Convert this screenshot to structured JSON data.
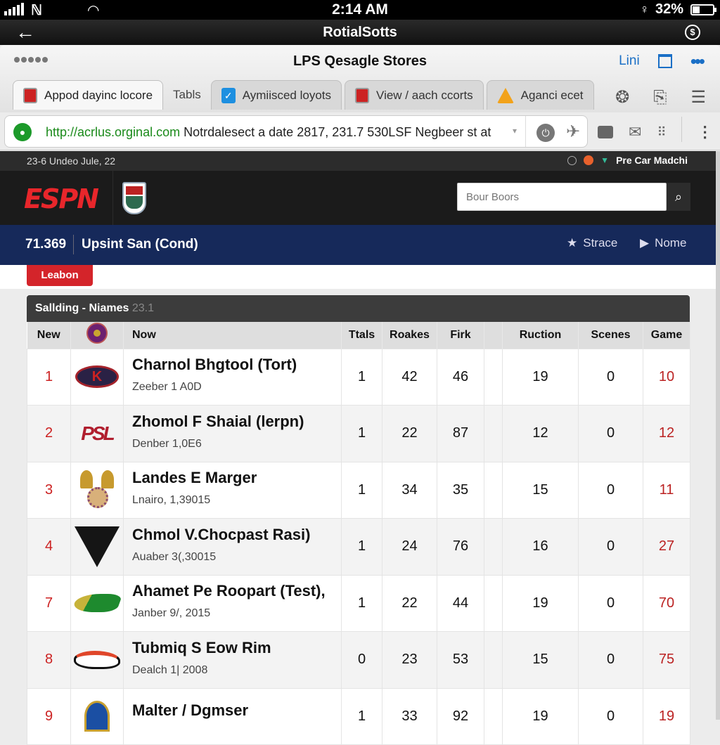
{
  "status_bar": {
    "carrier": "ℕ",
    "time": "2:14 AM",
    "battery_text": "32%",
    "battery_level": 0.32
  },
  "app_bar": {
    "title": "RotialSotts",
    "back_icon": "←",
    "info_icon": "$"
  },
  "browser": {
    "page_title": "LPS Qesagle Stores",
    "top_right_link": "Lini",
    "more_icon": "•••",
    "tabs": [
      {
        "label": "Appod dayinc locore",
        "icon": "shield-icon",
        "active": true
      },
      {
        "label": "Tabls",
        "icon": "",
        "active": false
      },
      {
        "label": "Aymiisced loyots",
        "icon": "bird-icon",
        "active": false
      },
      {
        "label": "View / aach ccorts",
        "icon": "shield-icon",
        "active": false
      },
      {
        "label": "Aganci ecet",
        "icon": "triangle-icon",
        "active": false
      }
    ],
    "tab_tools": {
      "menu_icon": "☰",
      "clip_icon": "⎘",
      "emblem_icon": "❂"
    },
    "address": {
      "host": "http://acrlus.orginal.com",
      "rest": " Notrdalesect a date 2817, 231.7 530LSF Negbeer st at",
      "secure_icon": "⬤"
    },
    "address_tools": {
      "mail_icon": "✉",
      "apps_icon": "⠿",
      "kebab_icon": "⋮",
      "power_icon": "⏻",
      "plane_icon": "✈"
    }
  },
  "info_strip": {
    "left": "23-6 Undeo Jule, 22",
    "right": "Pre Car Madchi"
  },
  "espn": {
    "logo": "ESPN",
    "search_placeholder": "Bour Boors",
    "search_icon": "⌕"
  },
  "nav": {
    "number": "71.369",
    "team": "Upsint San (Cond)",
    "actions": [
      {
        "icon": "★",
        "label": "Strace"
      },
      {
        "icon": "▶",
        "label": "Nome"
      }
    ]
  },
  "leabon_button": "Leabon",
  "standings": {
    "title": "Sallding - ",
    "title_strong": "Niames",
    "title_dim": "23.1",
    "columns": [
      "New",
      "",
      "Now",
      "Ttals",
      "Roakes",
      "Firk",
      "",
      "Ruction",
      "Scenes",
      "Game"
    ],
    "rows": [
      {
        "rank": "1",
        "logo": "k-logo",
        "name": "Charnol Bhgtool (Tort)",
        "sub": "Zeeber 1 A0D",
        "ttals": "1",
        "roakes": "42",
        "firk": "46",
        "ruction": "19",
        "scenes": "0",
        "game": "10"
      },
      {
        "rank": "2",
        "logo": "psl-logo",
        "name": "Zhomol F Shaial (lerpn)",
        "sub": "Denber 1,0E6",
        "ttals": "1",
        "roakes": "22",
        "firk": "87",
        "ruction": "12",
        "scenes": "0",
        "game": "12"
      },
      {
        "rank": "3",
        "logo": "crest-logo",
        "name": "Landes E Marger",
        "sub": "Lnairo, 1,39015",
        "ttals": "1",
        "roakes": "34",
        "firk": "35",
        "ruction": "15",
        "scenes": "0",
        "game": "11"
      },
      {
        "rank": "4",
        "logo": "falcon-logo",
        "name": "Chmol V.Chocpast Rasi)",
        "sub": "Auaber 3(,30015",
        "ttals": "1",
        "roakes": "24",
        "firk": "76",
        "ruction": "16",
        "scenes": "0",
        "game": "27"
      },
      {
        "rank": "7",
        "logo": "gator-logo",
        "name": "Ahamet Pe Roopart (Test),",
        "sub": "Janber 9/, 2015",
        "ttals": "1",
        "roakes": "22",
        "firk": "44",
        "ruction": "19",
        "scenes": "0",
        "game": "70"
      },
      {
        "rank": "8",
        "logo": "horse-logo",
        "name": "Tubmiq S Eow Rim",
        "sub": "Dealch 1| 2008",
        "ttals": "0",
        "roakes": "23",
        "firk": "53",
        "ruction": "15",
        "scenes": "0",
        "game": "75"
      },
      {
        "rank": "9",
        "logo": "church-logo",
        "name": "Malter / Dgmser",
        "sub": "",
        "ttals": "1",
        "roakes": "33",
        "firk": "92",
        "ruction": "19",
        "scenes": "0",
        "game": "19"
      }
    ]
  },
  "colors": {
    "espn_red": "#e8262b",
    "nav_blue": "#16295a",
    "accent_red": "#d4242a",
    "link_blue": "#1a6fc6"
  }
}
